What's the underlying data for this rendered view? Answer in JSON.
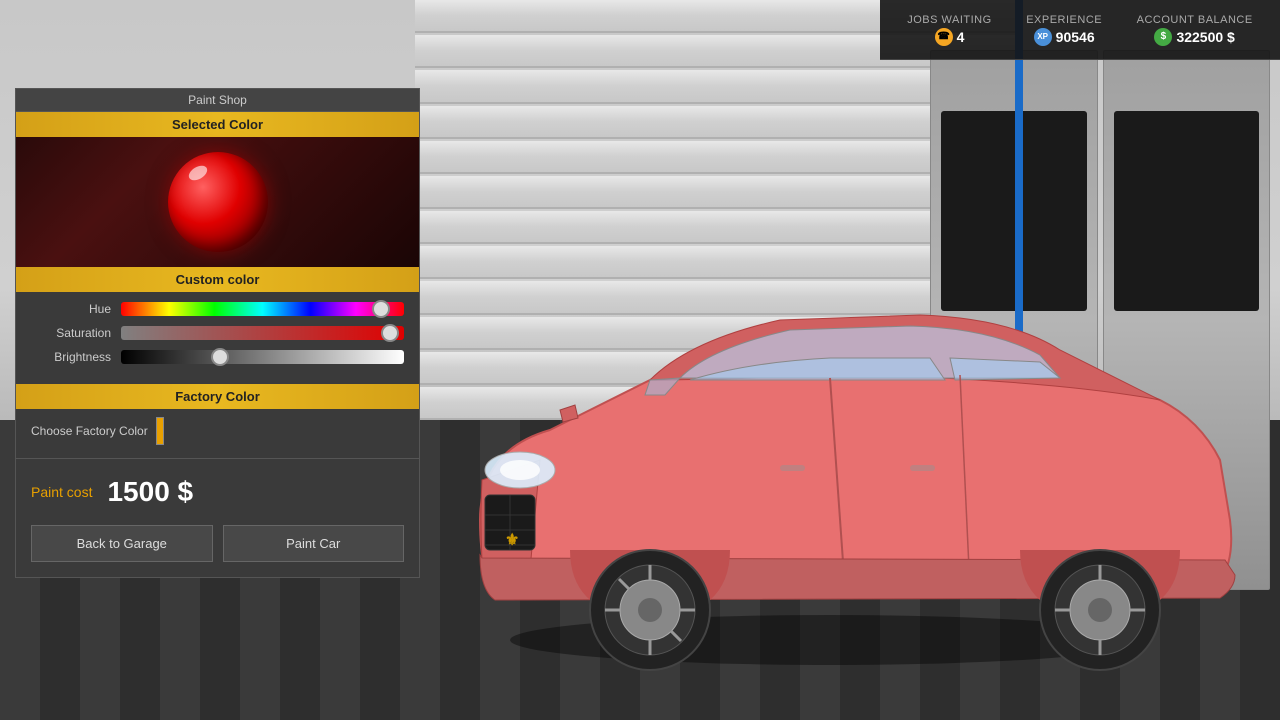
{
  "hud": {
    "jobs_waiting_label": "Jobs waiting",
    "jobs_waiting_value": "4",
    "experience_label": "Experience",
    "experience_value": "90546",
    "account_balance_label": "Account Balance",
    "account_balance_value": "322500 $"
  },
  "paint_shop": {
    "panel_title": "Paint Shop",
    "selected_color_header": "Selected Color",
    "custom_color_header": "Custom color",
    "hue_label": "Hue",
    "saturation_label": "Saturation",
    "brightness_label": "Brightness",
    "factory_color_header": "Factory Color",
    "choose_factory_color_label": "Choose Factory Color",
    "paint_cost_label": "Paint cost",
    "paint_cost_value": "1500 $",
    "back_to_garage_button": "Back to Garage",
    "paint_car_button": "Paint Car",
    "hue_position": "92",
    "saturation_position": "95",
    "brightness_position": "35"
  }
}
